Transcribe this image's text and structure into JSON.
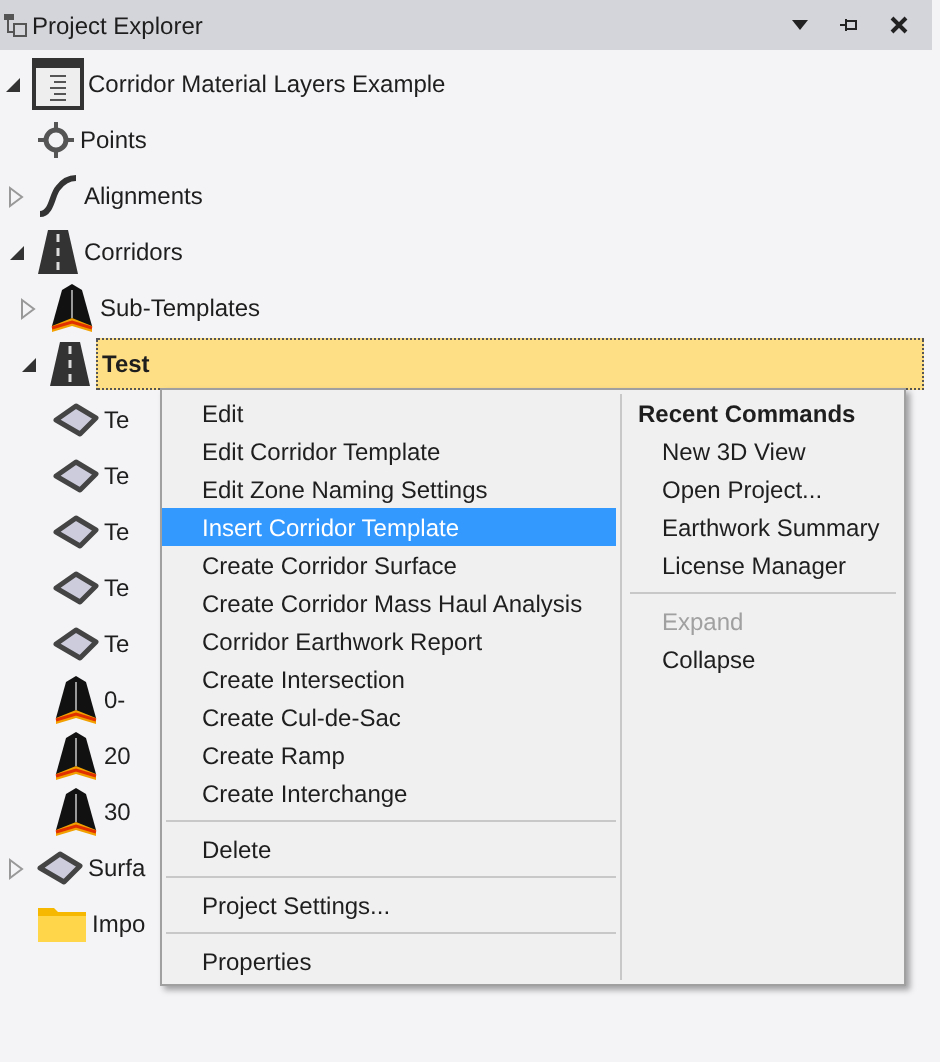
{
  "panel": {
    "title": "Project Explorer"
  },
  "tree": [
    {
      "label": "Corridor Material Layers Example",
      "kind": "project",
      "expanded": true,
      "selected": false,
      "children": [
        {
          "label": "Points",
          "kind": "points",
          "selected": false
        },
        {
          "label": "Alignments",
          "kind": "alignment",
          "expanded": false,
          "selected": false
        },
        {
          "label": "Corridors",
          "kind": "corridor",
          "expanded": true,
          "selected": false,
          "children": [
            {
              "label": "Sub-Templates",
              "kind": "template",
              "expanded": false,
              "selected": false
            },
            {
              "label": "Test",
              "kind": "corridor",
              "expanded": true,
              "selected": true,
              "children": [
                {
                  "label": "Te",
                  "kind": "surface",
                  "selected": false
                },
                {
                  "label": "Te",
                  "kind": "surface",
                  "selected": false
                },
                {
                  "label": "Te",
                  "kind": "surface",
                  "selected": false
                },
                {
                  "label": "Te",
                  "kind": "surface",
                  "selected": false
                },
                {
                  "label": "Te",
                  "kind": "surface",
                  "selected": false
                },
                {
                  "label": "0-",
                  "kind": "template",
                  "selected": false
                },
                {
                  "label": "20",
                  "kind": "template",
                  "selected": false
                },
                {
                  "label": "30",
                  "kind": "template",
                  "selected": false
                }
              ]
            }
          ]
        },
        {
          "label": "Surfa",
          "kind": "surface",
          "expanded": false,
          "selected": false
        },
        {
          "label": "Impo",
          "kind": "folder",
          "selected": false
        }
      ]
    }
  ],
  "context_menu": {
    "items": [
      {
        "kind": "item",
        "label": "Edit",
        "selected": false
      },
      {
        "kind": "item",
        "label": "Edit Corridor Template",
        "selected": false
      },
      {
        "kind": "item",
        "label": "Edit Zone Naming Settings",
        "selected": false
      },
      {
        "kind": "item",
        "label": "Insert Corridor Template",
        "selected": true
      },
      {
        "kind": "item",
        "label": "Create Corridor Surface",
        "selected": false
      },
      {
        "kind": "item",
        "label": "Create Corridor Mass Haul Analysis",
        "selected": false
      },
      {
        "kind": "item",
        "label": "Corridor Earthwork Report",
        "selected": false
      },
      {
        "kind": "item",
        "label": "Create Intersection",
        "selected": false
      },
      {
        "kind": "item",
        "label": "Create Cul-de-Sac",
        "selected": false
      },
      {
        "kind": "item",
        "label": "Create Ramp",
        "selected": false
      },
      {
        "kind": "item",
        "label": "Create Interchange",
        "selected": false
      },
      {
        "kind": "separator"
      },
      {
        "kind": "item",
        "label": "Delete",
        "selected": false
      },
      {
        "kind": "separator"
      },
      {
        "kind": "item",
        "label": "Project Settings...",
        "selected": false
      },
      {
        "kind": "separator"
      },
      {
        "kind": "item",
        "label": "Properties",
        "selected": false
      }
    ],
    "recent": {
      "heading": "Recent Commands",
      "items": [
        {
          "kind": "item",
          "label": "New 3D View",
          "disabled": false
        },
        {
          "kind": "item",
          "label": "Open Project...",
          "disabled": false
        },
        {
          "kind": "item",
          "label": "Earthwork Summary",
          "disabled": false
        },
        {
          "kind": "item",
          "label": "License Manager",
          "disabled": false
        },
        {
          "kind": "separator"
        },
        {
          "kind": "item",
          "label": "Expand",
          "disabled": true
        },
        {
          "kind": "item",
          "label": "Collapse",
          "disabled": false
        }
      ]
    }
  }
}
